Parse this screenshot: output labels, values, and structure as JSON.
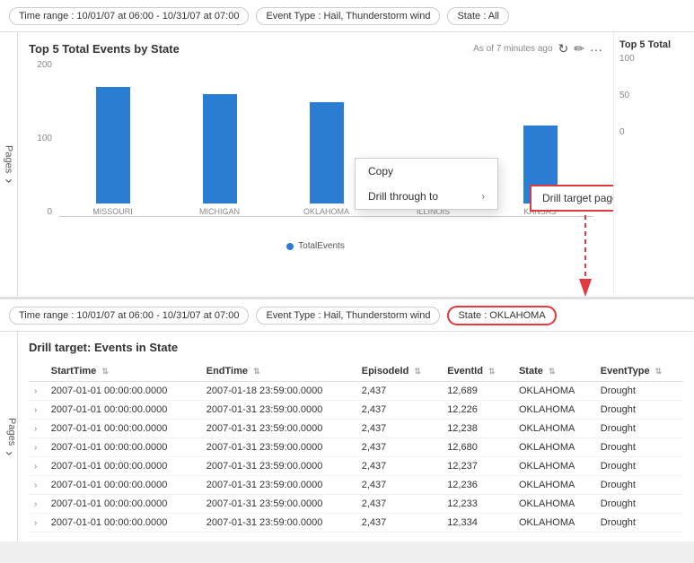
{
  "topFilterBar": {
    "pills": [
      {
        "label": "Time range : 10/01/07 at 06:00 - 10/31/07 at 07:00"
      },
      {
        "label": "Event Type : Hail, Thunderstorm wind"
      },
      {
        "label": "State : All"
      }
    ]
  },
  "topChart": {
    "title": "Top 5 Total Events by State",
    "asOf": "As of 7 minutes ago",
    "legend": "TotalEvents",
    "yAxis": [
      "200",
      "100",
      "0"
    ],
    "bars": [
      {
        "label": "MISSOURI",
        "heightPct": 75
      },
      {
        "label": "MICHIGAN",
        "heightPct": 70
      },
      {
        "label": "OKLAHOMA",
        "heightPct": 65
      },
      {
        "label": "ILLINOIS",
        "heightPct": 20
      },
      {
        "label": "KANSAS",
        "heightPct": 50
      }
    ]
  },
  "rightPartialChart": {
    "title": "Top 5 Total",
    "yAxis": [
      "100",
      "50",
      "0"
    ]
  },
  "contextMenu": {
    "copyLabel": "Copy",
    "drillThroughLabel": "Drill through to",
    "drillTargetLabel": "Drill target page"
  },
  "secondFilterBar": {
    "pills": [
      {
        "label": "Time range : 10/01/07 at 06:00 - 10/31/07 at 07:00",
        "highlighted": false
      },
      {
        "label": "Event Type : Hail, Thunderstorm wind",
        "highlighted": false
      },
      {
        "label": "State : OKLAHOMA",
        "highlighted": true
      }
    ]
  },
  "drillTable": {
    "title": "Drill target: Events in State",
    "columns": [
      "StartTime",
      "EndTime",
      "EpisodeId",
      "EventId",
      "State",
      "EventType"
    ],
    "rows": [
      {
        "startTime": "2007-01-01 00:00:00.0000",
        "endTime": "2007-01-18 23:59:00.0000",
        "episodeId": "2,437",
        "eventId": "12,689",
        "state": "OKLAHOMA",
        "eventType": "Drought"
      },
      {
        "startTime": "2007-01-01 00:00:00.0000",
        "endTime": "2007-01-31 23:59:00.0000",
        "episodeId": "2,437",
        "eventId": "12,226",
        "state": "OKLAHOMA",
        "eventType": "Drought"
      },
      {
        "startTime": "2007-01-01 00:00:00.0000",
        "endTime": "2007-01-31 23:59:00.0000",
        "episodeId": "2,437",
        "eventId": "12,238",
        "state": "OKLAHOMA",
        "eventType": "Drought"
      },
      {
        "startTime": "2007-01-01 00:00:00.0000",
        "endTime": "2007-01-31 23:59:00.0000",
        "episodeId": "2,437",
        "eventId": "12,680",
        "state": "OKLAHOMA",
        "eventType": "Drought"
      },
      {
        "startTime": "2007-01-01 00:00:00.0000",
        "endTime": "2007-01-31 23:59:00.0000",
        "episodeId": "2,437",
        "eventId": "12,237",
        "state": "OKLAHOMA",
        "eventType": "Drought"
      },
      {
        "startTime": "2007-01-01 00:00:00.0000",
        "endTime": "2007-01-31 23:59:00.0000",
        "episodeId": "2,437",
        "eventId": "12,236",
        "state": "OKLAHOMA",
        "eventType": "Drought"
      },
      {
        "startTime": "2007-01-01 00:00:00.0000",
        "endTime": "2007-01-31 23:59:00.0000",
        "episodeId": "2,437",
        "eventId": "12,233",
        "state": "OKLAHOMA",
        "eventType": "Drought"
      },
      {
        "startTime": "2007-01-01 00:00:00.0000",
        "endTime": "2007-01-31 23:59:00.0000",
        "episodeId": "2,437",
        "eventId": "12,334",
        "state": "OKLAHOMA",
        "eventType": "Drought"
      }
    ]
  },
  "pages": {
    "label": "Pages"
  }
}
